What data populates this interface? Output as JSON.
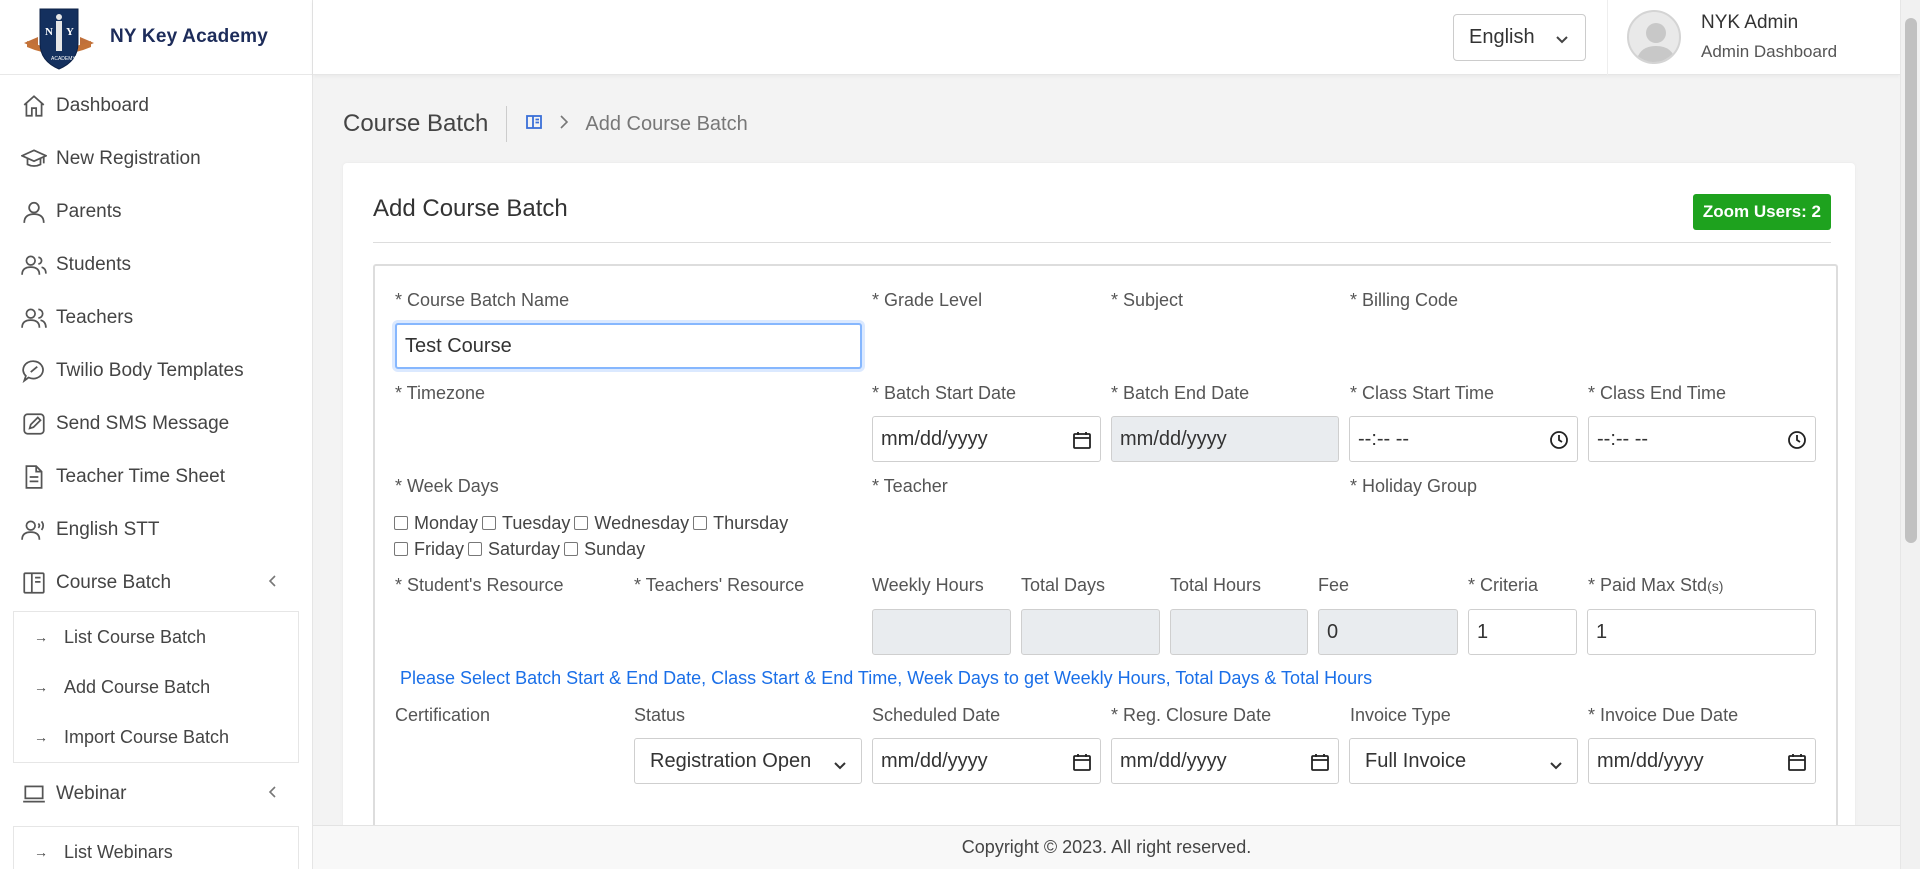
{
  "brand": {
    "name": "NY Key Academy",
    "logo_letters": "N Y",
    "logo_tagline": "ACADEMY"
  },
  "sidebar": {
    "items": [
      {
        "label": "Dashboard",
        "icon": "home-icon"
      },
      {
        "label": "New Registration",
        "icon": "graduation-cap-icon"
      },
      {
        "label": "Parents",
        "icon": "user-icon"
      },
      {
        "label": "Students",
        "icon": "users-icon"
      },
      {
        "label": "Teachers",
        "icon": "users-icon"
      },
      {
        "label": "Twilio Body Templates",
        "icon": "chat-icon"
      },
      {
        "label": "Send SMS Message",
        "icon": "edit-icon"
      },
      {
        "label": "Teacher Time Sheet",
        "icon": "document-icon"
      },
      {
        "label": "English STT",
        "icon": "voice-icon"
      },
      {
        "label": "Course Batch",
        "icon": "book-icon"
      }
    ],
    "course_batch_sub": [
      "List Course Batch",
      "Add Course Batch",
      "Import Course Batch"
    ],
    "webinar": {
      "label": "Webinar",
      "icon": "laptop-icon"
    },
    "webinar_sub": [
      "List Webinars"
    ]
  },
  "topbar": {
    "language": "English",
    "user_name": "NYK Admin",
    "user_role": "Admin Dashboard"
  },
  "breadcrumb": {
    "title": "Course Batch",
    "current": "Add Course Batch"
  },
  "card": {
    "title": "Add Course Batch",
    "zoom_badge": "Zoom Users: 2"
  },
  "form": {
    "course_batch_name": {
      "label": "* Course Batch Name",
      "value": "Test Course"
    },
    "grade_level": {
      "label": "* Grade Level"
    },
    "subject": {
      "label": "* Subject"
    },
    "billing_code": {
      "label": "* Billing Code"
    },
    "timezone": {
      "label": "* Timezone"
    },
    "batch_start_date": {
      "label": "* Batch Start Date",
      "value": "mm/dd/yyyy"
    },
    "batch_end_date": {
      "label": "* Batch End Date",
      "value": "mm/dd/yyyy"
    },
    "class_start_time": {
      "label": "* Class Start Time",
      "value": "--:-- --"
    },
    "class_end_time": {
      "label": "* Class End Time",
      "value": "--:-- --"
    },
    "week_days": {
      "label": "* Week Days",
      "days": [
        "Monday",
        "Tuesday",
        "Wednesday",
        "Thursday",
        "Friday",
        "Saturday",
        "Sunday"
      ]
    },
    "teacher": {
      "label": "* Teacher"
    },
    "holiday_group": {
      "label": "* Holiday Group"
    },
    "student_resource": {
      "label": "* Student's Resource"
    },
    "teacher_resource": {
      "label": "* Teachers' Resource"
    },
    "weekly_hours": {
      "label": "Weekly Hours",
      "value": ""
    },
    "total_days": {
      "label": "Total Days",
      "value": ""
    },
    "total_hours": {
      "label": "Total Hours",
      "value": ""
    },
    "fee": {
      "label": "Fee",
      "value": "0"
    },
    "criteria": {
      "label": "* Criteria",
      "value": "1"
    },
    "paid_max_std": {
      "label": "* Paid Max Std",
      "label_suffix": "(s)",
      "value": "1"
    },
    "hint": "Please Select Batch Start & End Date, Class Start & End Time, Week Days to get Weekly Hours, Total Days & Total Hours",
    "certification": {
      "label": "Certification"
    },
    "status": {
      "label": "Status",
      "value": "Registration Open"
    },
    "scheduled_date": {
      "label": "Scheduled Date",
      "value": "mm/dd/yyyy"
    },
    "reg_closure_date": {
      "label": "* Reg. Closure Date",
      "value": "mm/dd/yyyy"
    },
    "invoice_type": {
      "label": "Invoice Type",
      "value": "Full Invoice"
    },
    "invoice_due_date": {
      "label": "* Invoice Due Date",
      "value": "mm/dd/yyyy"
    }
  },
  "footer": {
    "copyright": "Copyright © 2023. All right reserved."
  },
  "colors": {
    "accent": "#1a6fe8",
    "badge_green": "#1ea21e",
    "brand_navy": "#1d2c5a"
  }
}
